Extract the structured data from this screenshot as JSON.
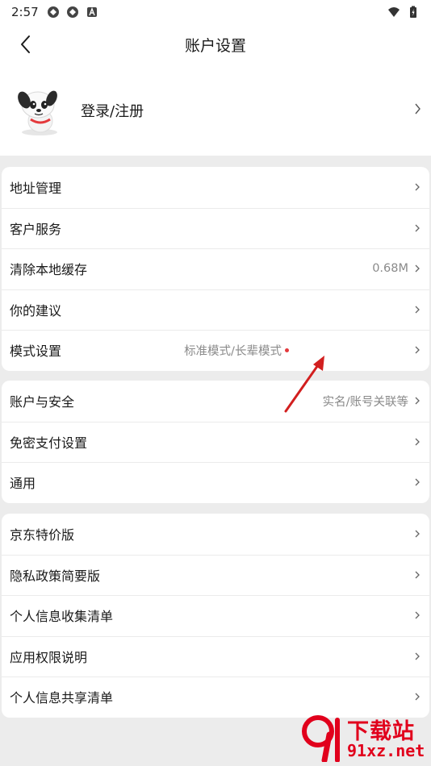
{
  "status_bar": {
    "time": "2:57"
  },
  "header": {
    "title": "账户设置"
  },
  "profile": {
    "login_label": "登录/注册"
  },
  "groups": [
    {
      "items": [
        {
          "label": "地址管理",
          "value": ""
        },
        {
          "label": "客户服务",
          "value": ""
        },
        {
          "label": "清除本地缓存",
          "value": "0.68M"
        },
        {
          "label": "你的建议",
          "value": ""
        },
        {
          "label": "模式设置",
          "value": "标准模式/长辈模式",
          "dot": true
        }
      ]
    },
    {
      "items": [
        {
          "label": "账户与安全",
          "value": "实名/账号关联等"
        },
        {
          "label": "免密支付设置",
          "value": ""
        },
        {
          "label": "通用",
          "value": ""
        }
      ]
    },
    {
      "items": [
        {
          "label": "京东特价版",
          "value": ""
        },
        {
          "label": "隐私政策简要版",
          "value": ""
        },
        {
          "label": "个人信息收集清单",
          "value": ""
        },
        {
          "label": "应用权限说明",
          "value": ""
        },
        {
          "label": "个人信息共享清单",
          "value": ""
        }
      ]
    }
  ],
  "watermark": {
    "title": "下载站",
    "site": "91xz.net"
  },
  "colors": {
    "accent_red": "#e4393c",
    "background": "#ececec",
    "secondary_text": "#8a8a8a"
  }
}
